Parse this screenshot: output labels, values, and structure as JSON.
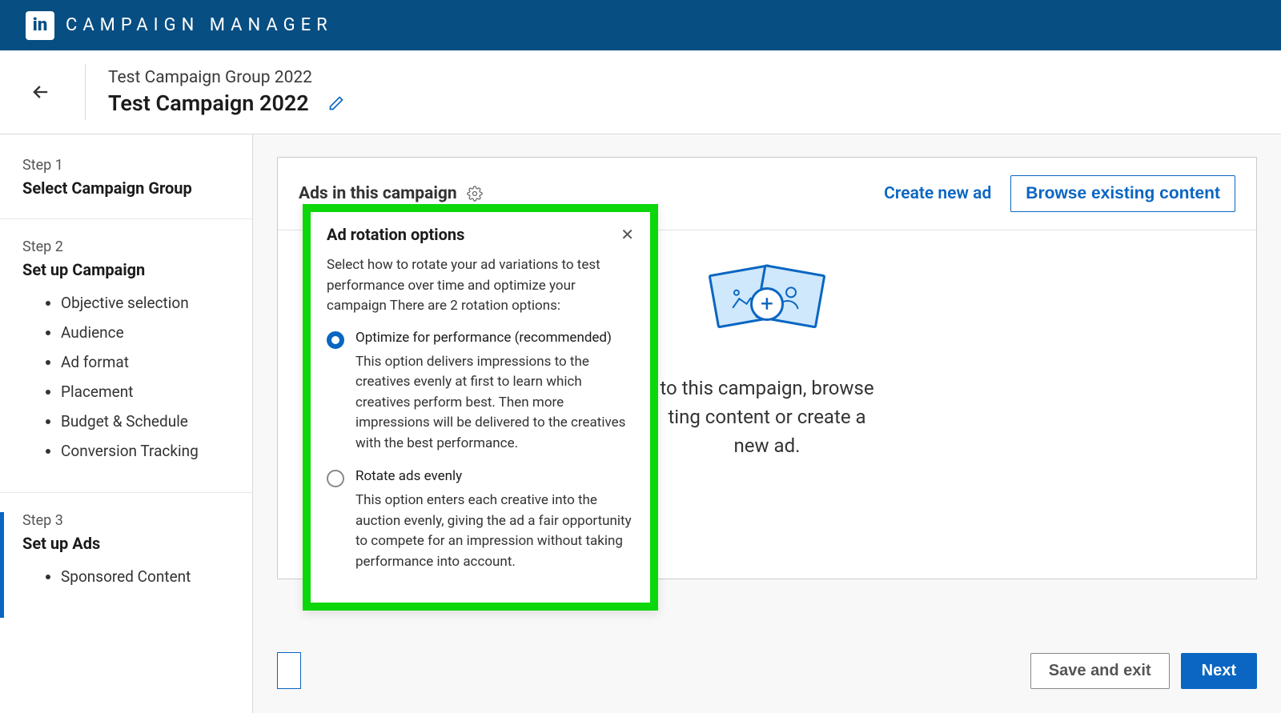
{
  "banner": {
    "app_name": "CAMPAIGN MANAGER",
    "logo_text": "in"
  },
  "breadcrumb": {
    "group": "Test Campaign Group 2022",
    "campaign": "Test Campaign 2022"
  },
  "sidebar": {
    "step1": {
      "num": "Step 1",
      "title": "Select Campaign Group"
    },
    "step2": {
      "num": "Step 2",
      "title": "Set up Campaign",
      "items": [
        "Objective selection",
        "Audience",
        "Ad format",
        "Placement",
        "Budget & Schedule",
        "Conversion Tracking"
      ]
    },
    "step3": {
      "num": "Step 3",
      "title": "Set up Ads",
      "items": [
        "Sponsored Content"
      ]
    }
  },
  "panel": {
    "title": "Ads in this campaign",
    "create": "Create new ad",
    "browse": "Browse existing content",
    "empty_l1": "to this campaign, browse",
    "empty_l2": "ting content or create a",
    "empty_l3": "new ad."
  },
  "footer": {
    "save": "Save and exit",
    "next": "Next"
  },
  "popover": {
    "title": "Ad rotation options",
    "desc": "Select how to rotate your ad variations to test performance over time and optimize your campaign There are 2 rotation options:",
    "opt1_label": "Optimize for performance (recommended)",
    "opt1_desc": "This option delivers impressions to the creatives evenly at first to learn which creatives perform best. Then more impressions will be delivered to the creatives with the best performance.",
    "opt2_label": "Rotate ads evenly",
    "opt2_desc": "This option enters each creative into the auction evenly, giving the ad a fair opportunity to compete for an impression without taking performance into account."
  }
}
